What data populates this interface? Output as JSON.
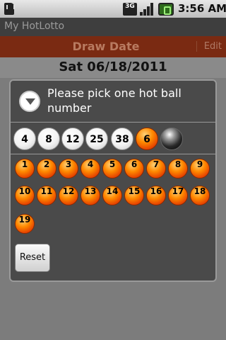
{
  "status_bar": {
    "time": "3:56 AM",
    "network": "3G"
  },
  "app": {
    "title": "My HotLotto",
    "draw_header": "Draw Date",
    "edit_label": "Edit",
    "draw_date": "Sat 06/18/2011"
  },
  "dialog": {
    "title": "Please pick one hot ball number",
    "selected_white": [
      "4",
      "8",
      "12",
      "25",
      "38"
    ],
    "selected_hot": "6",
    "hot_options": [
      "1",
      "2",
      "3",
      "4",
      "5",
      "6",
      "7",
      "8",
      "9",
      "10",
      "11",
      "12",
      "13",
      "14",
      "15",
      "16",
      "17",
      "18",
      "19"
    ],
    "reset_label": "Reset"
  },
  "colors": {
    "accent": "#ff6a00",
    "header": "#7a2a12",
    "dialog_bg": "#4a4a4a"
  }
}
